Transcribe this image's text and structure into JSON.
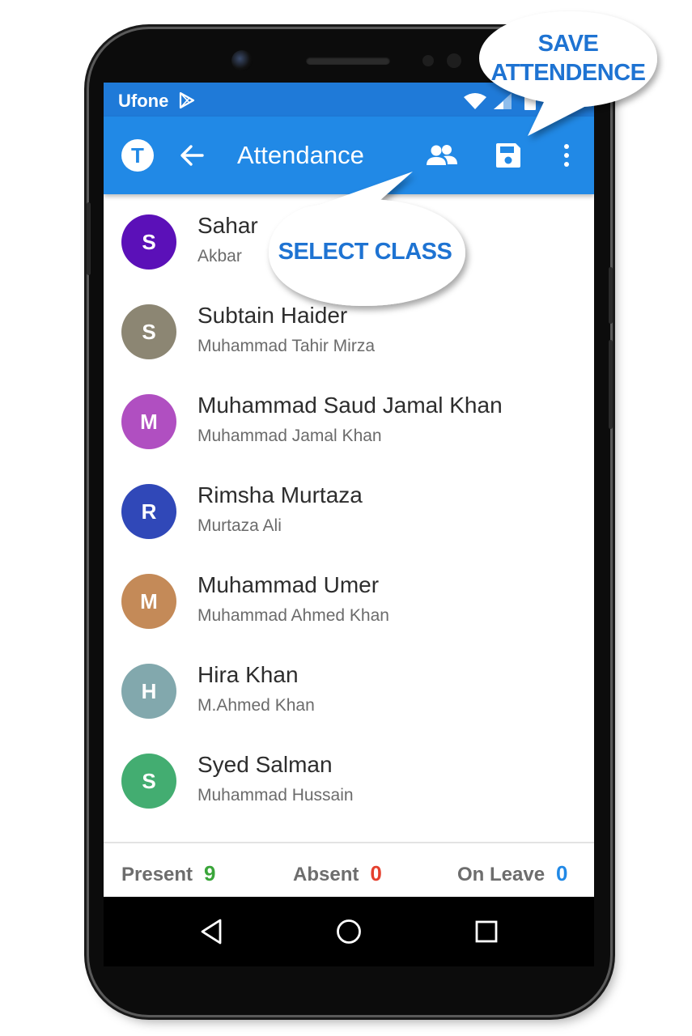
{
  "status_bar": {
    "carrier": "Ufone"
  },
  "app_bar": {
    "logo_letter": "T",
    "title": "Attendance"
  },
  "students": [
    {
      "initial": "S",
      "name": "Sahar",
      "parent": "Akbar",
      "color": "#5b10b8"
    },
    {
      "initial": "S",
      "name": "Subtain Haider",
      "parent": "Muhammad Tahir Mirza",
      "color": "#8c8673"
    },
    {
      "initial": "M",
      "name": "Muhammad Saud Jamal Khan",
      "parent": "Muhammad Jamal Khan",
      "color": "#b04fc1"
    },
    {
      "initial": "R",
      "name": "Rimsha Murtaza",
      "parent": "Murtaza Ali",
      "color": "#3048b8"
    },
    {
      "initial": "M",
      "name": "Muhammad Umer",
      "parent": "Muhammad Ahmed Khan",
      "color": "#c48a58"
    },
    {
      "initial": "H",
      "name": "Hira Khan",
      "parent": "M.Ahmed Khan",
      "color": "#82a8ad"
    },
    {
      "initial": "S",
      "name": "Syed Salman",
      "parent": "Muhammad Hussain",
      "color": "#43ad71"
    }
  ],
  "summary": {
    "present_label": "Present",
    "present_count": "9",
    "absent_label": "Absent",
    "absent_count": "0",
    "leave_label": "On Leave",
    "leave_count": "0"
  },
  "callouts": {
    "save_line1": "SAVE",
    "save_line2": "ATTENDENCE",
    "select_class": "SELECT CLASS"
  },
  "icons": {
    "back": "arrow-left-icon",
    "select_class": "people-icon",
    "save": "floppy-disk-icon",
    "more": "more-vert-icon"
  },
  "colors": {
    "app_bar": "#2189e6",
    "status_bar": "#1f7ad8",
    "present": "#3aa53a",
    "absent": "#e5402e",
    "leave": "#2189e6",
    "callout_text": "#1e73d2"
  }
}
